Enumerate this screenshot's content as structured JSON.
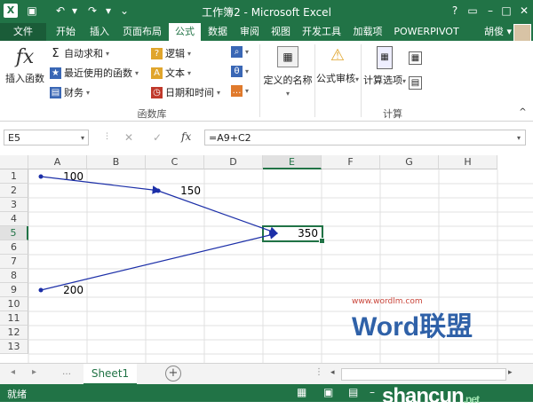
{
  "app": {
    "title": "工作簿2 - Microsoft Excel",
    "help": "?"
  },
  "tabs": [
    {
      "label": "文件",
      "key": "file"
    },
    {
      "label": "开始",
      "key": "home"
    },
    {
      "label": "插入",
      "key": "insert"
    },
    {
      "label": "页面布局",
      "key": "layout"
    },
    {
      "label": "公式",
      "key": "formulas"
    },
    {
      "label": "数据",
      "key": "data"
    },
    {
      "label": "审阅",
      "key": "review"
    },
    {
      "label": "视图",
      "key": "view"
    },
    {
      "label": "开发工具",
      "key": "dev"
    },
    {
      "label": "加载项",
      "key": "addins"
    },
    {
      "label": "POWERPIVOT",
      "key": "powerpivot"
    }
  ],
  "user": {
    "name": "胡俊"
  },
  "ribbon": {
    "insert_function": "插入函数",
    "autosum": "自动求和",
    "recent": "最近使用的函数",
    "finance": "财务",
    "logical": "逻辑",
    "text": "文本",
    "datetime": "日期和时间",
    "defined_names": "定义的名称",
    "formula_audit": "公式审核",
    "calc_options": "计算选项",
    "group_function_library": "函数库",
    "group_calc": "计算"
  },
  "formula_bar": {
    "name_box": "E5",
    "fx": "fx",
    "formula": "=A9+C2"
  },
  "grid": {
    "columns": [
      "A",
      "B",
      "C",
      "D",
      "E",
      "F",
      "G",
      "H"
    ],
    "rows": [
      "1",
      "2",
      "3",
      "4",
      "5",
      "6",
      "7",
      "8",
      "9",
      "10",
      "11",
      "12",
      "13"
    ],
    "selected_cell": "E5",
    "cells": [
      {
        "ref": "A1",
        "value": "100"
      },
      {
        "ref": "C2",
        "value": "150"
      },
      {
        "ref": "E5",
        "value": "350"
      },
      {
        "ref": "A9",
        "value": "200"
      }
    ],
    "trace_color": "#1c2fa8"
  },
  "sheets": [
    {
      "label": "Sheet1",
      "active": true
    }
  ],
  "status": {
    "text": "就绪"
  },
  "watermark": {
    "url": "www.wordlm.com",
    "brand": "Word联盟",
    "site": "shancun",
    "site_suffix": ".net"
  }
}
